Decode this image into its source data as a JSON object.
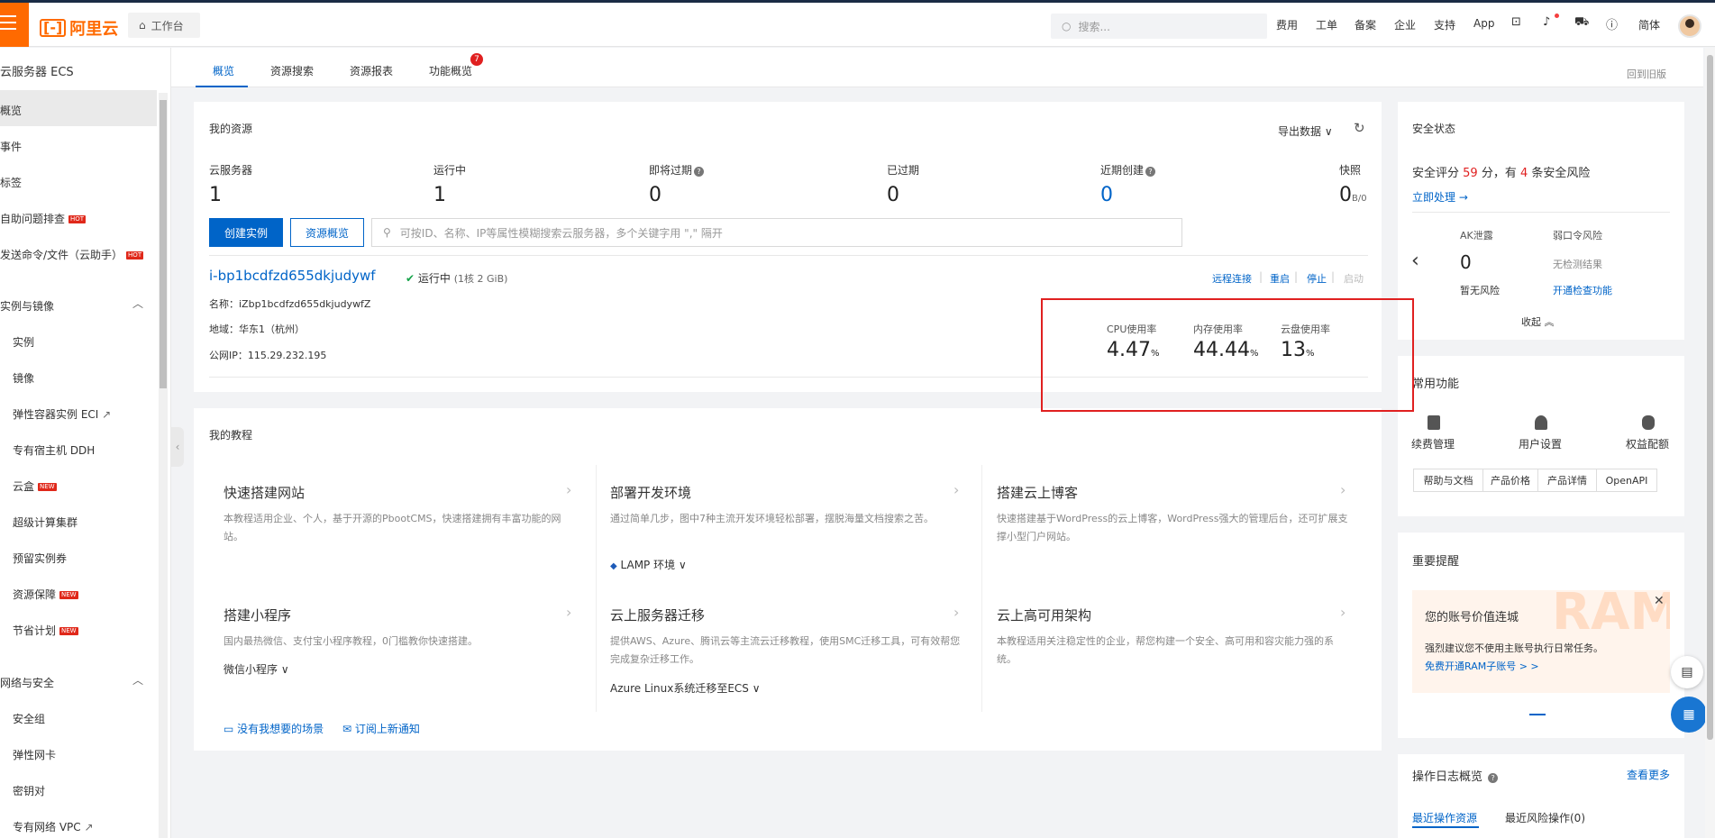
{
  "topbar": {
    "logo_text": "阿里云",
    "workbench": "工作台",
    "search_placeholder": "搜索...",
    "nav": [
      "费用",
      "工单",
      "备案",
      "企业",
      "支持",
      "App"
    ],
    "lang": "简体"
  },
  "sidebar": {
    "title": "云服务器 ECS",
    "items": [
      {
        "label": "概览"
      },
      {
        "label": "事件"
      },
      {
        "label": "标签"
      },
      {
        "label": "自助问题排查",
        "badge": "HOT"
      },
      {
        "label": "发送命令/文件（云助手）",
        "badge": "HOT"
      }
    ],
    "section1": "实例与镜像",
    "section1_items": [
      {
        "label": "实例"
      },
      {
        "label": "镜像"
      },
      {
        "label": "弹性容器实例 ECI"
      },
      {
        "label": "专有宿主机 DDH"
      },
      {
        "label": "云盒",
        "badge": "NEW"
      },
      {
        "label": "超级计算集群"
      },
      {
        "label": "预留实例券"
      },
      {
        "label": "资源保障",
        "badge": "NEW"
      },
      {
        "label": "节省计划",
        "badge": "NEW"
      }
    ],
    "section2": "网络与安全",
    "section2_items": [
      {
        "label": "安全组"
      },
      {
        "label": "弹性网卡"
      },
      {
        "label": "密钥对"
      },
      {
        "label": "专有网络 VPC"
      }
    ]
  },
  "tabs": {
    "items": [
      "概览",
      "资源搜索",
      "资源报表",
      "功能概览"
    ],
    "badge": "7",
    "back_old": "回到旧版"
  },
  "resources": {
    "title": "我的资源",
    "export": "导出数据",
    "stats": [
      {
        "label": "云服务器",
        "value": "1"
      },
      {
        "label": "运行中",
        "value": "1"
      },
      {
        "label": "即将过期",
        "value": "0"
      },
      {
        "label": "已过期",
        "value": "0"
      },
      {
        "label": "近期创建",
        "value": "0"
      },
      {
        "label": "快照",
        "value": "0",
        "suffix": "B/0"
      }
    ],
    "create_btn": "创建实例",
    "overview_btn": "资源概览",
    "search_placeholder": "可按ID、名称、IP等属性模糊搜索云服务器，多个关键字用 \",\" 隔开",
    "instance": {
      "id": "i-bp1bcdfzd655dkjudywf",
      "status": "运行中",
      "spec": "(1核 2 GiB)",
      "name": "名称：iZbp1bcdfzd655dkjudywfZ",
      "region": "地域：华东1（杭州）",
      "ip": "公网IP：115.29.232.195",
      "actions": [
        "远程连接",
        "重启",
        "停止",
        "启动"
      ]
    },
    "usage": [
      {
        "label": "CPU使用率",
        "value": "4.47",
        "unit": "%"
      },
      {
        "label": "内存使用率",
        "value": "44.44",
        "unit": "%"
      },
      {
        "label": "云盘使用率",
        "value": "13",
        "unit": "%"
      }
    ]
  },
  "tutorials": {
    "title": "我的教程",
    "items": [
      {
        "title": "快速搭建网站",
        "desc": "本教程适用企业、个人，基于开源的PbootCMS，快速搭建拥有丰富功能的网站。"
      },
      {
        "title": "部署开发环境",
        "desc": "通过简单几步，图中7种主流开发环境轻松部署，摆脱海量文档搜索之苦。",
        "link": "LAMP 环境"
      },
      {
        "title": "搭建云上博客",
        "desc": "快速搭建基于WordPress的云上博客，WordPress强大的管理后台，还可扩展支撑小型门户网站。"
      },
      {
        "title": "搭建小程序",
        "desc": "国内最热微信、支付宝小程序教程，0门槛教你快速搭建。",
        "link": "微信小程序"
      },
      {
        "title": "云上服务器迁移",
        "desc": "提供AWS、Azure、腾讯云等主流云迁移教程，使用SMC迁移工具，可有效帮您完成复杂迁移工作。",
        "link": "Azure Linux系统迁移至ECS"
      },
      {
        "title": "云上高可用架构",
        "desc": "本教程适用关注稳定性的企业，帮您构建一个安全、高可用和容灾能力强的系统。"
      }
    ],
    "footer_links": [
      "没有我想要的场景",
      "订阅上新通知"
    ]
  },
  "security": {
    "title": "安全状态",
    "score_prefix": "安全评分",
    "score": "59",
    "score_mid": "分，有",
    "risk_count": "4",
    "score_suffix": "条安全风险",
    "handle": "立即处理",
    "ak_label": "AK泄露",
    "ak_value": "0",
    "ak_note": "暂无风险",
    "weak_label": "弱口令风险",
    "weak_note": "无检测结果",
    "weak_link": "开通检查功能",
    "collapse": "收起"
  },
  "common": {
    "title": "常用功能",
    "icons": [
      "续费管理",
      "用户设置",
      "权益配额"
    ],
    "buttons": [
      "帮助与文档",
      "产品价格",
      "产品详情",
      "OpenAPI"
    ]
  },
  "reminder": {
    "title": "重要提醒",
    "banner_title": "您的账号价值连城",
    "banner_text": "强烈建议您不使用主账号执行日常任务。",
    "banner_link": "免费开通RAM子账号 > >",
    "watermark": "RAM"
  },
  "oplog": {
    "title": "操作日志概览",
    "more": "查看更多",
    "tabs": [
      "最近操作资源",
      "最近风险操作(0)"
    ]
  },
  "colors": {
    "brand": "#ff6a00",
    "primary": "#0064c8",
    "danger": "#e02020"
  }
}
